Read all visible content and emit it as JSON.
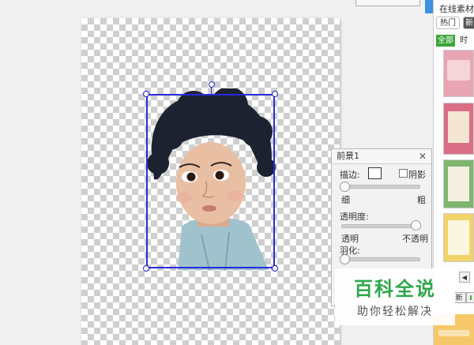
{
  "foreground_panel": {
    "title": "前景1",
    "close_glyph": "✕",
    "stroke_label": "描边:",
    "shadow_label": "阴影",
    "thin_label": "细",
    "thick_label": "粗",
    "opacity_label": "透明度:",
    "transparent_label": "透明",
    "opaque_label": "不透明",
    "feather_label": "羽化:"
  },
  "material_panel": {
    "title": "在线素材",
    "tabs": [
      "热门",
      "新"
    ],
    "filters": [
      "全部",
      "时"
    ],
    "bottom_button_label": "新",
    "accent_color": "#3c93e0"
  },
  "watermark": {
    "title": "百科全说",
    "subtitle": "助你轻松解决",
    "color": "#2fa64a"
  },
  "icons": {
    "close": "close-icon",
    "left_arrow": "arrow-left-icon",
    "download": "download-icon"
  }
}
